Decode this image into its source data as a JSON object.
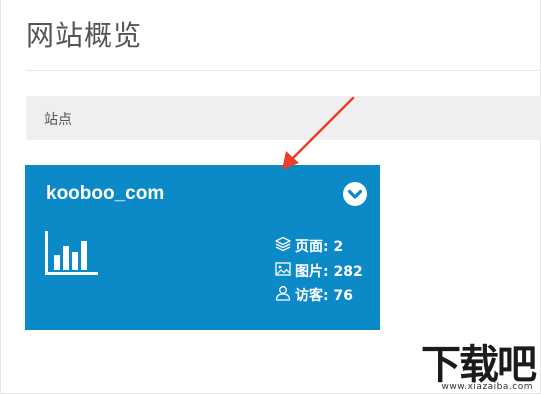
{
  "page": {
    "title": "网站概览"
  },
  "section": {
    "label": "站点"
  },
  "site": {
    "name": "kooboo_com",
    "stats": [
      {
        "icon": "layers-icon",
        "label": "页面: 2"
      },
      {
        "icon": "image-icon",
        "label": "图片: 282"
      },
      {
        "icon": "user-icon",
        "label": "访客: 76"
      }
    ]
  },
  "colors": {
    "card": "#0c8ac8",
    "arrow": "#e8402a",
    "section_bg": "#efefef"
  },
  "watermark": {
    "brand": "下载吧",
    "url": "www.xiazaiba.com"
  }
}
